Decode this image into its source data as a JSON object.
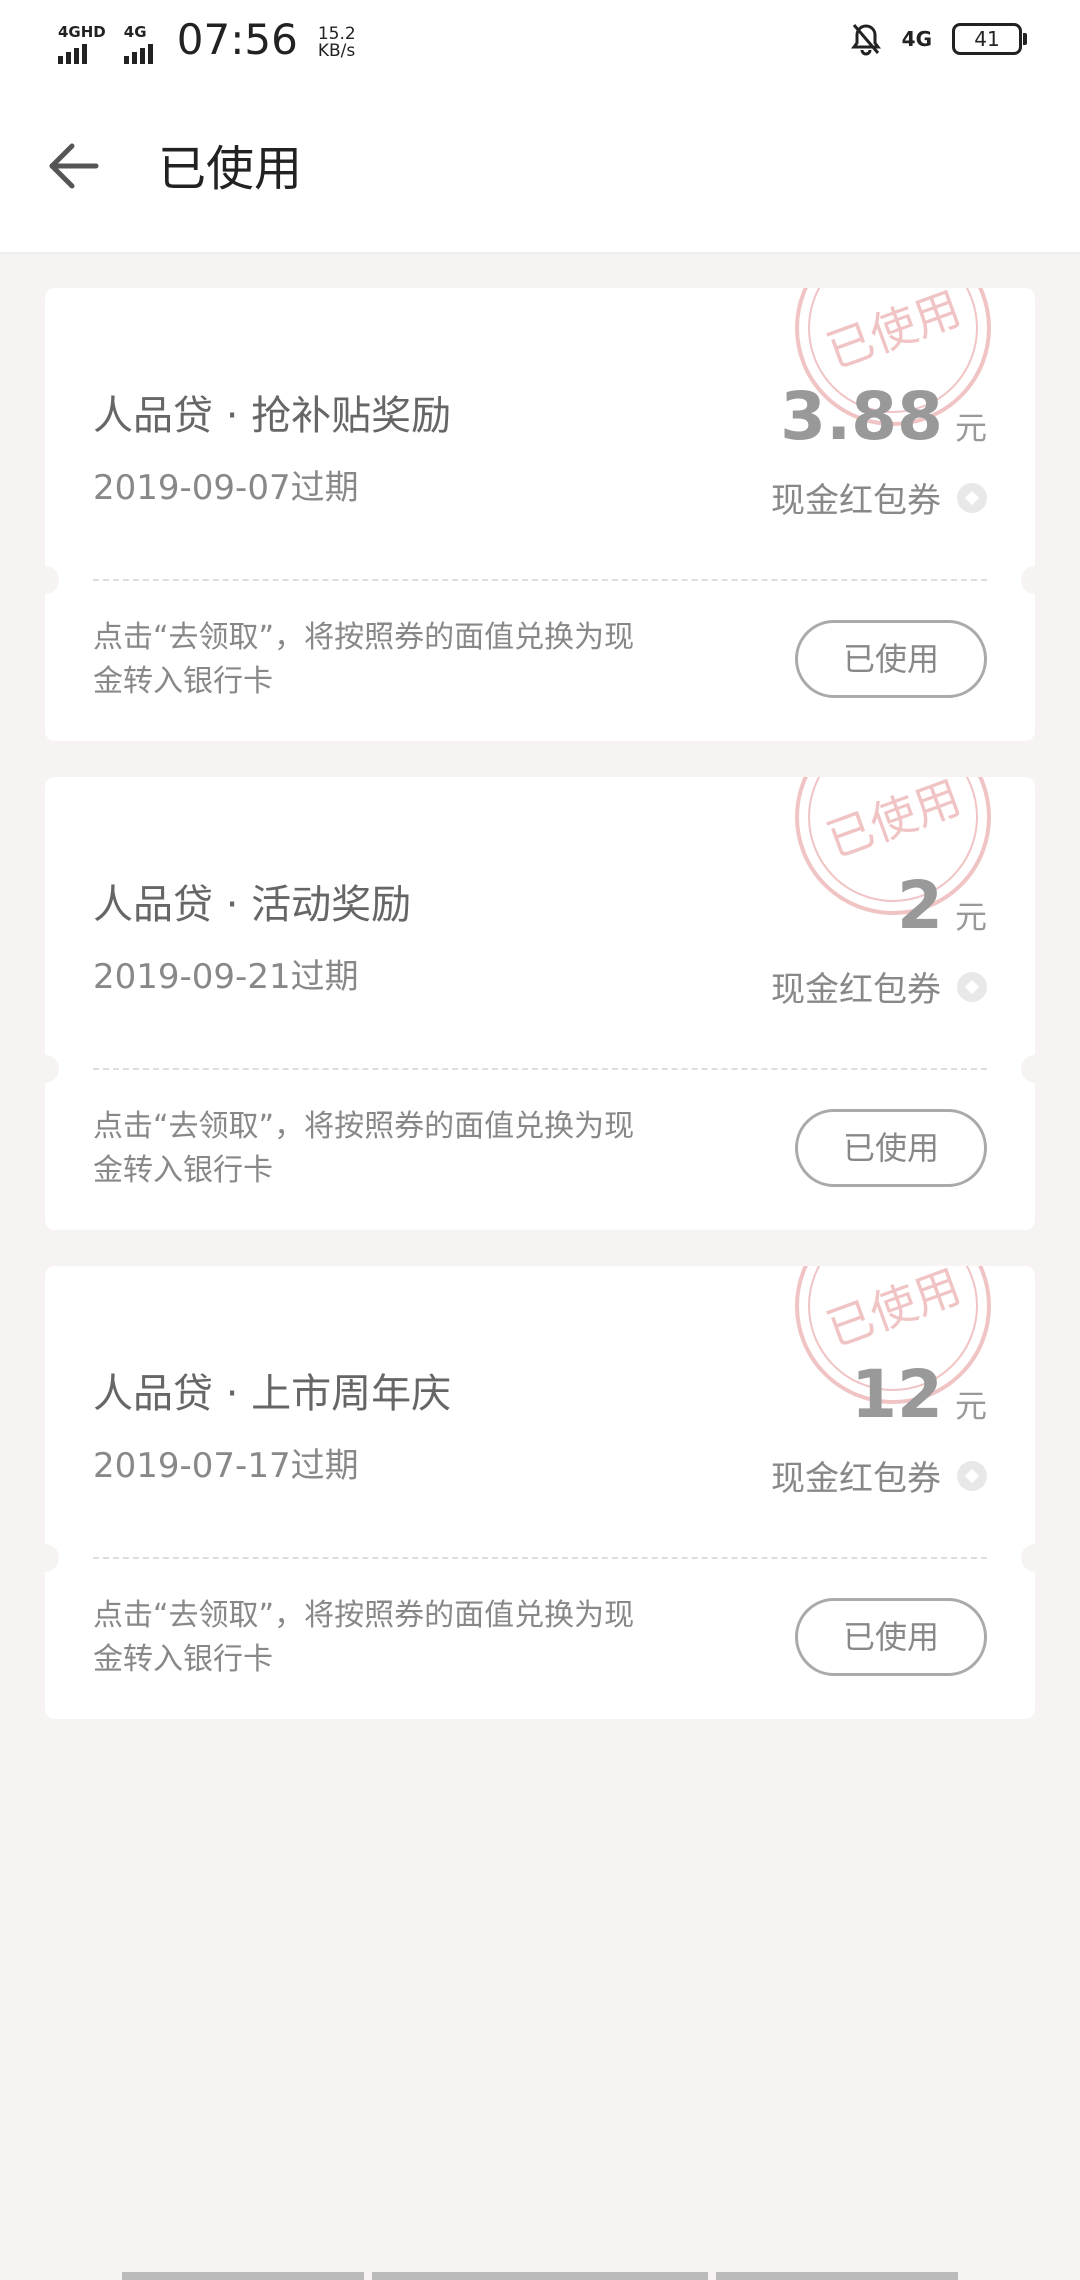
{
  "status_bar": {
    "signal1_label": "4GHD",
    "signal2_label": "4G",
    "time": "07:56",
    "speed_value": "15.2",
    "speed_unit": "KB/s",
    "network": "4G",
    "battery": "41"
  },
  "header": {
    "title": "已使用"
  },
  "coupons": [
    {
      "name": "人品贷 · 抢补贴奖励",
      "expiry": "2019-09-07过期",
      "amount": "3.88",
      "unit": "元",
      "type": "现金红包券",
      "description": "点击“去领取”，将按照券的面值兑换为现金转入银行卡",
      "button": "已使用",
      "stamp": "已使用"
    },
    {
      "name": "人品贷 · 活动奖励",
      "expiry": "2019-09-21过期",
      "amount": "2",
      "unit": "元",
      "type": "现金红包券",
      "description": "点击“去领取”，将按照券的面值兑换为现金转入银行卡",
      "button": "已使用",
      "stamp": "已使用"
    },
    {
      "name": "人品贷 · 上市周年庆",
      "expiry": "2019-07-17过期",
      "amount": "12",
      "unit": "元",
      "type": "现金红包券",
      "description": "点击“去领取”，将按照券的面值兑换为现金转入银行卡",
      "button": "已使用",
      "stamp": "已使用"
    }
  ],
  "colors": {
    "background": "#f7f3f3",
    "stamp": "#e8a3a3",
    "muted_text": "#888888"
  }
}
